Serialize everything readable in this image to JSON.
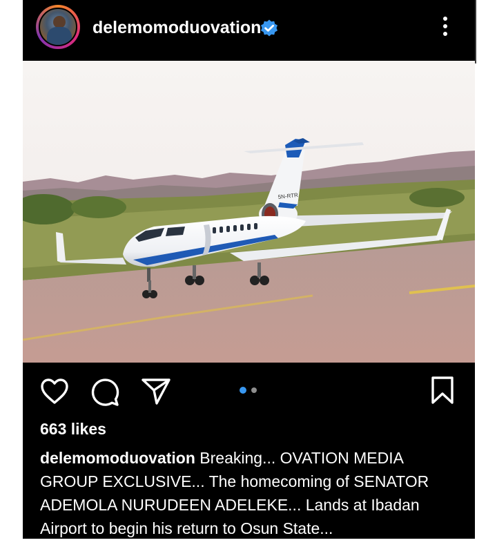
{
  "post": {
    "username": "delemomoduovation",
    "likes": "663 likes",
    "caption": "Breaking... OVATION MEDIA GROUP EXCLUSIVE... The homecoming of SENATOR ADEMOLA NURUDEEN ADELEKE... Lands at Ibadan Airport to begin his return to Osun State...",
    "aircraft_registration": "5N-RTR"
  },
  "carousel": {
    "total": 2,
    "active": 1
  },
  "icons": {
    "verified": "verified-badge-icon",
    "more": "more-vertical-icon",
    "like": "heart-icon",
    "comment": "comment-bubble-icon",
    "share": "paper-plane-icon",
    "save": "bookmark-icon"
  },
  "colors": {
    "background": "#000000",
    "text": "#ffffff",
    "verified": "#3897f0",
    "carousel_active": "#3897f0",
    "carousel_inactive": "#8e8e8e"
  }
}
